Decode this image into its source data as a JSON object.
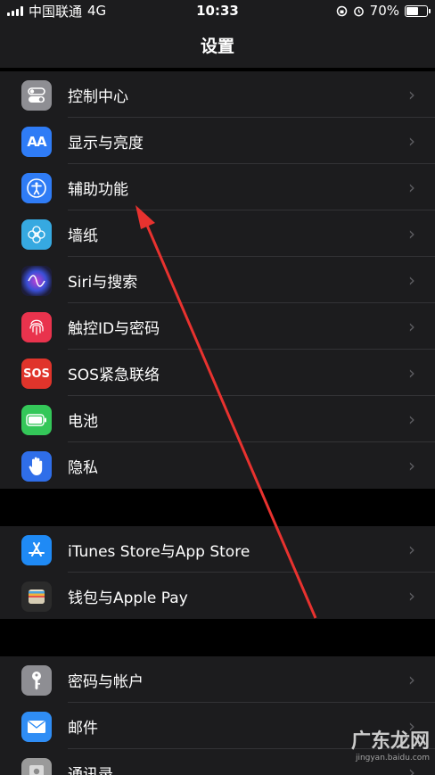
{
  "status_bar": {
    "carrier": "中国联通",
    "network": "4G",
    "time": "10:33",
    "battery_percent": "70%",
    "battery_level": 0.7
  },
  "nav": {
    "title": "设置"
  },
  "groups": [
    {
      "items": [
        {
          "label": "控制中心",
          "icon": "control-center-icon",
          "color": "#8e8e93"
        },
        {
          "label": "显示与亮度",
          "icon": "display-brightness-icon",
          "color": "#2f7cf6"
        },
        {
          "label": "辅助功能",
          "icon": "accessibility-icon",
          "color": "#2f7cf6"
        },
        {
          "label": "墙纸",
          "icon": "wallpaper-icon",
          "color": "#36a9e1"
        },
        {
          "label": "Siri与搜索",
          "icon": "siri-icon",
          "color": "#1d1d3a"
        },
        {
          "label": "触控ID与密码",
          "icon": "touch-id-icon",
          "color": "#e9334d"
        },
        {
          "label": "SOS紧急联络",
          "icon": "sos-icon",
          "color": "#e0342b"
        },
        {
          "label": "电池",
          "icon": "battery-icon",
          "color": "#34c759"
        },
        {
          "label": "隐私",
          "icon": "privacy-hand-icon",
          "color": "#2f6ee9"
        }
      ]
    },
    {
      "items": [
        {
          "label": "iTunes Store与App Store",
          "icon": "app-store-icon",
          "color": "#1f8af5"
        },
        {
          "label": "钱包与Apple Pay",
          "icon": "wallet-icon",
          "color": "#2b2b2b"
        }
      ]
    },
    {
      "items": [
        {
          "label": "密码与帐户",
          "icon": "key-icon",
          "color": "#8e8e93"
        },
        {
          "label": "邮件",
          "icon": "mail-icon",
          "color": "#2f8df5"
        },
        {
          "label": "通讯录",
          "icon": "contacts-icon",
          "color": "#9a9a9a"
        }
      ]
    }
  ],
  "watermark": {
    "text": "广东龙网",
    "url": "jingyan.baidu.com"
  }
}
